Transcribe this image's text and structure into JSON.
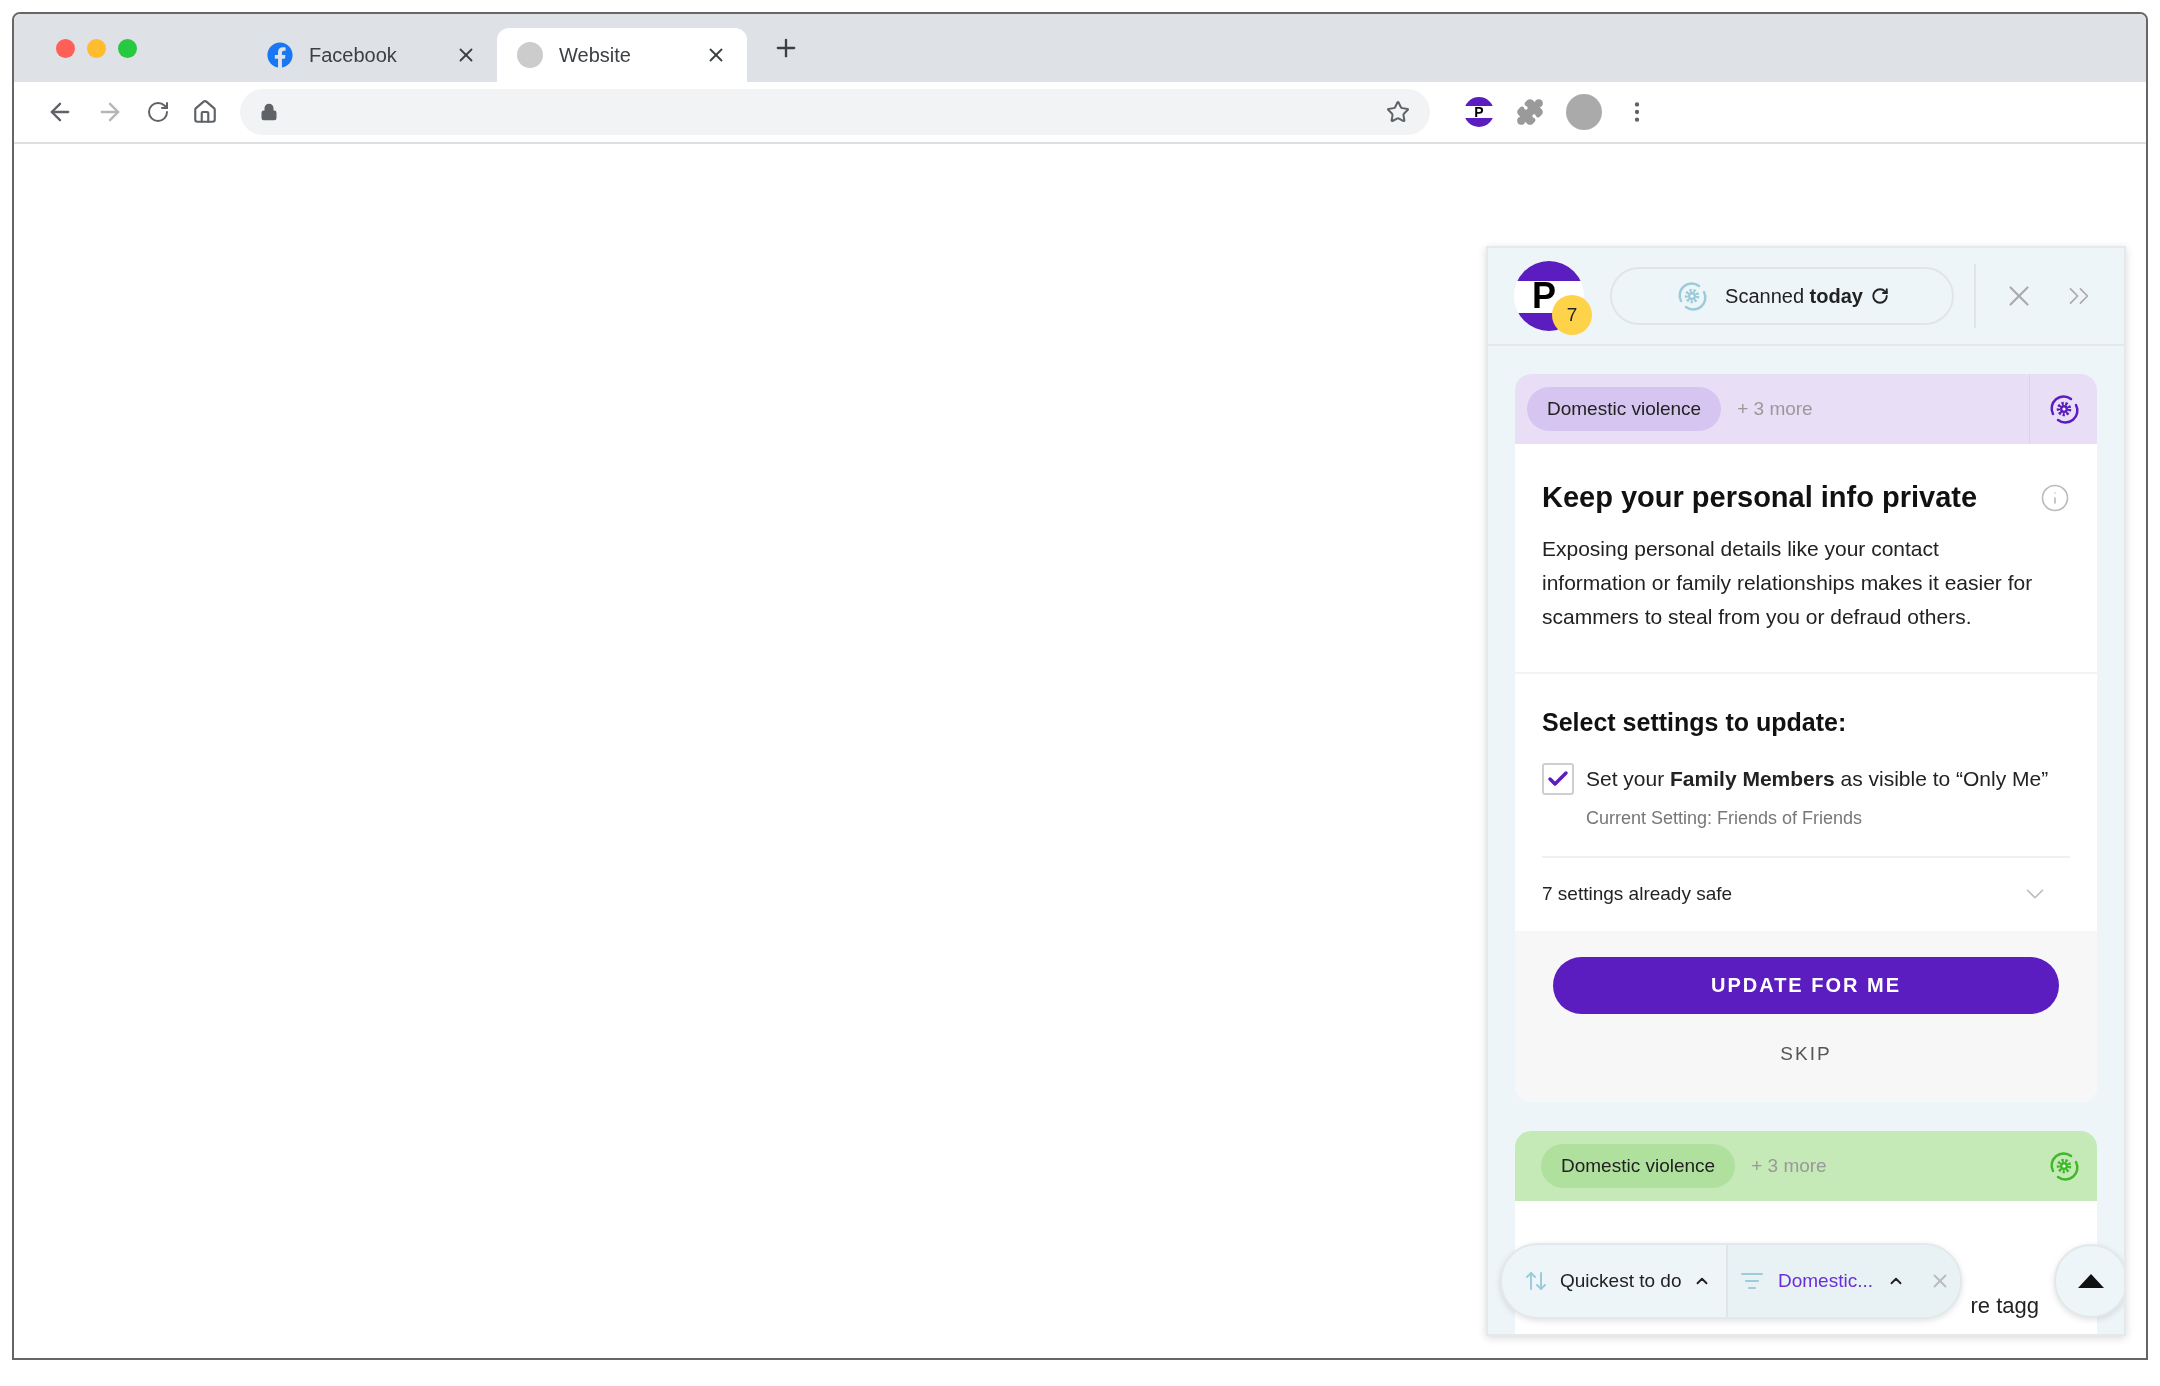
{
  "browser": {
    "tabs": [
      {
        "title": "Facebook",
        "kind": "facebook",
        "selected": false
      },
      {
        "title": "Website",
        "kind": "generic",
        "selected": true
      }
    ],
    "extension_letter": "P"
  },
  "panel": {
    "logo_letter": "P",
    "badge_count": "7",
    "scan_status": {
      "label": "Scanned",
      "emphasis": "today"
    },
    "cards": [
      {
        "kind": "pending",
        "color": "#e8dff7",
        "tag": "Domestic violence",
        "more": "+ 3 more",
        "title": "Keep your personal info private",
        "description": "Exposing personal details like your contact information or family relationships makes it easier for scammers to steal from you or defraud others.",
        "settings_heading": "Select settings to update:",
        "settings": [
          {
            "label": "Set your **Family Members** as visible to “Only Me”",
            "current": "Current Setting: Friends of Friends",
            "checked": true
          }
        ],
        "safe_summary": {
          "label": "7 settings already safe",
          "expanded": false
        },
        "primary_action": "UPDATE FOR ME",
        "secondary_action": "SKIP"
      },
      {
        "kind": "safe",
        "color": "#c6e9b8",
        "tag": "Domestic violence",
        "more": "+ 3 more",
        "partial_text": "re tagg"
      }
    ],
    "toolbar": {
      "sort": "Quickest to do",
      "filter": "Domestic..."
    }
  }
}
